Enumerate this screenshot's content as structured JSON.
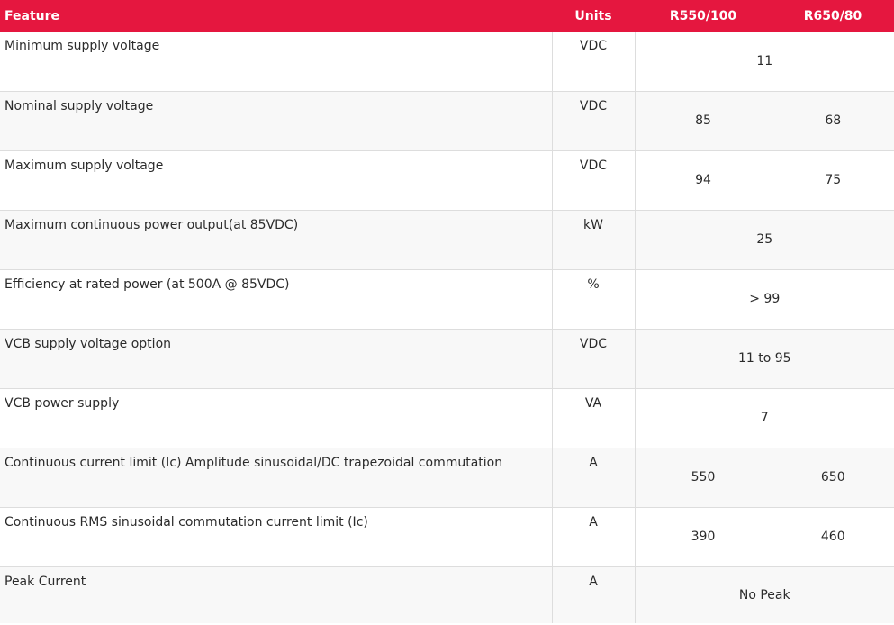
{
  "table": {
    "headers": {
      "feature": "Feature",
      "units": "Units",
      "model_a": "R550/100",
      "model_b": "R650/80"
    },
    "rows": [
      {
        "feature": "Minimum supply voltage",
        "units": "VDC",
        "value": "11"
      },
      {
        "feature": "Nominal supply voltage",
        "units": "VDC",
        "value_a": "85",
        "value_b": "68"
      },
      {
        "feature": "Maximum supply voltage",
        "units": "VDC",
        "value_a": "94",
        "value_b": "75"
      },
      {
        "feature": "Maximum continuous power output(at 85VDC)",
        "units": "kW",
        "value": "25"
      },
      {
        "feature": "Efficiency at rated power (at 500A @ 85VDC)",
        "units": "%",
        "value": "> 99"
      },
      {
        "feature": "VCB supply voltage option",
        "units": "VDC",
        "value": "11 to 95"
      },
      {
        "feature": "VCB power supply",
        "units": "VA",
        "value": "7"
      },
      {
        "feature": "Continuous current limit (Ic) Amplitude sinusoidal/DC trapezoidal commutation",
        "units": "A",
        "value_a": "550",
        "value_b": "650"
      },
      {
        "feature": "Continuous RMS sinusoidal commutation current limit (Ic)",
        "units": "A",
        "value_a": "390",
        "value_b": "460"
      },
      {
        "feature": "Peak Current",
        "units": "A",
        "value": "No Peak"
      }
    ]
  },
  "colors": {
    "header_background": "#e5173f",
    "header_text": "#ffffff",
    "row_alt_background": "#f8f8f8",
    "border": "#dddddd"
  }
}
